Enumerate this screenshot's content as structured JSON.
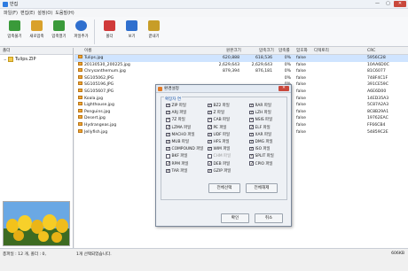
{
  "window": {
    "title": "반집",
    "minimize": "—",
    "maximize": "▢",
    "close": "✕"
  },
  "menu": [
    "파일(F)",
    "편집(E)",
    "설정(O)",
    "도움말(H)"
  ],
  "toolbar": [
    {
      "label": "압축풀기",
      "icon": "extract-icon",
      "color": "#3a9a3a"
    },
    {
      "label": "새로압축",
      "icon": "new-archive-icon",
      "color": "#d9a12b"
    },
    {
      "label": "압축열기",
      "icon": "open-archive-icon",
      "color": "#3a9a3a"
    },
    {
      "label": "파일추가",
      "icon": "add-file-icon",
      "color": "#2f6fce"
    },
    {
      "label": "폴더",
      "icon": "folder-icon",
      "color": "#d03a3a"
    },
    {
      "label": "보기",
      "icon": "view-icon",
      "color": "#2f6fce"
    },
    {
      "label": "끝내기",
      "icon": "exit-icon",
      "color": "#c79d28"
    }
  ],
  "left": {
    "header": "폴더",
    "tree_root": "Tulips.ZIP"
  },
  "list": {
    "columns": [
      "이름",
      "원본크기",
      "압축크기",
      "압축률",
      "암호화",
      "디렉토리",
      "CRC"
    ],
    "rows": [
      {
        "name": "Tulips.jpg",
        "orig": "620,888",
        "comp": "618,536",
        "ratio": "0%",
        "enc": "false",
        "dir": "",
        "crc": "5956C28",
        "selected": true
      },
      {
        "name": "20130530_200225.jpg",
        "orig": "2,629,643",
        "comp": "2,629,643",
        "ratio": "0%",
        "enc": "false",
        "dir": "",
        "crc": "10AA6D0C"
      },
      {
        "name": "Chrysanthemum.jpg",
        "orig": "879,394",
        "comp": "876,181",
        "ratio": "0%",
        "enc": "false",
        "dir": "",
        "crc": "81C6077"
      },
      {
        "name": "SG105062.JPG",
        "orig": "",
        "comp": "",
        "ratio": "0%",
        "enc": "false",
        "dir": "",
        "crc": "748F4C1F"
      },
      {
        "name": "SG105196.JPG",
        "orig": "",
        "comp": "",
        "ratio": "0%",
        "enc": "false",
        "dir": "",
        "crc": "391CE59C"
      },
      {
        "name": "SG105607.JPG",
        "orig": "",
        "comp": "",
        "ratio": "0%",
        "enc": "false",
        "dir": "",
        "crc": "A6E6D00"
      },
      {
        "name": "Koala.jpg",
        "orig": "",
        "comp": "",
        "ratio": "0%",
        "enc": "false",
        "dir": "",
        "crc": "14ED35A3"
      },
      {
        "name": "Lighthouse.jpg",
        "orig": "",
        "comp": "",
        "ratio": "0%",
        "enc": "false",
        "dir": "",
        "crc": "5C87A2A3"
      },
      {
        "name": "Penguins.jpg",
        "orig": "",
        "comp": "",
        "ratio": "0%",
        "enc": "false",
        "dir": "",
        "crc": "8C8B29A1"
      },
      {
        "name": "Desert.jpg",
        "orig": "",
        "comp": "",
        "ratio": "0%",
        "enc": "false",
        "dir": "",
        "crc": "19762EAC"
      },
      {
        "name": "Hydrangeas.jpg",
        "orig": "",
        "comp": "",
        "ratio": "0%",
        "enc": "false",
        "dir": "",
        "crc": "FF66CB4"
      },
      {
        "name": "Jellyfish.jpg",
        "orig": "",
        "comp": "",
        "ratio": "0%",
        "enc": "false",
        "dir": "",
        "crc": "54859C2E"
      }
    ]
  },
  "status": {
    "left": "총파일 : 12 개, 폴더 : 0,",
    "center": "1개 선택되었습니다.",
    "right": "606KB"
  },
  "dialog": {
    "title": "환경설정",
    "close": "✕",
    "group_title": "확장자 연",
    "checkboxes": [
      {
        "label": "ZIP 파일",
        "checked": true
      },
      {
        "label": "BZ2 파일",
        "checked": true
      },
      {
        "label": "RAR 파일",
        "checked": true
      },
      {
        "label": "ARJ 파일",
        "checked": true
      },
      {
        "label": "Z 파일",
        "checked": true
      },
      {
        "label": "LZH 파일",
        "checked": true
      },
      {
        "label": "7Z 파일",
        "checked": true
      },
      {
        "label": "CAB 파일",
        "checked": true
      },
      {
        "label": "NSIS 파일",
        "checked": true
      },
      {
        "label": "LZMA 파일",
        "checked": true
      },
      {
        "label": "PE 파일",
        "checked": true
      },
      {
        "label": "ELF 파일",
        "checked": true
      },
      {
        "label": "MACHO 파일",
        "checked": true
      },
      {
        "label": "UDF 파일",
        "checked": true
      },
      {
        "label": "XAR 파일",
        "checked": true
      },
      {
        "label": "MUB 파일",
        "checked": true
      },
      {
        "label": "HFS 파일",
        "checked": true
      },
      {
        "label": "DMG 파일",
        "checked": true
      },
      {
        "label": "COMPOUND 파일",
        "checked": true
      },
      {
        "label": "WIM 파일",
        "checked": true
      },
      {
        "label": "ISO 파일",
        "checked": true
      },
      {
        "label": "BKF 파일",
        "checked": false
      },
      {
        "label": "CHM 파일",
        "checked": false,
        "disabled": true
      },
      {
        "label": "SPLIT 파일",
        "checked": true
      },
      {
        "label": "RPM 파일",
        "checked": true
      },
      {
        "label": "DEB 파일",
        "checked": true
      },
      {
        "label": "CPIO 파일",
        "checked": true
      },
      {
        "label": "TAR 파일",
        "checked": true
      },
      {
        "label": "GZIP 파일",
        "checked": true
      }
    ],
    "select_all": "전체선택",
    "deselect_all": "전체해제",
    "ok": "확인",
    "cancel": "취소"
  }
}
